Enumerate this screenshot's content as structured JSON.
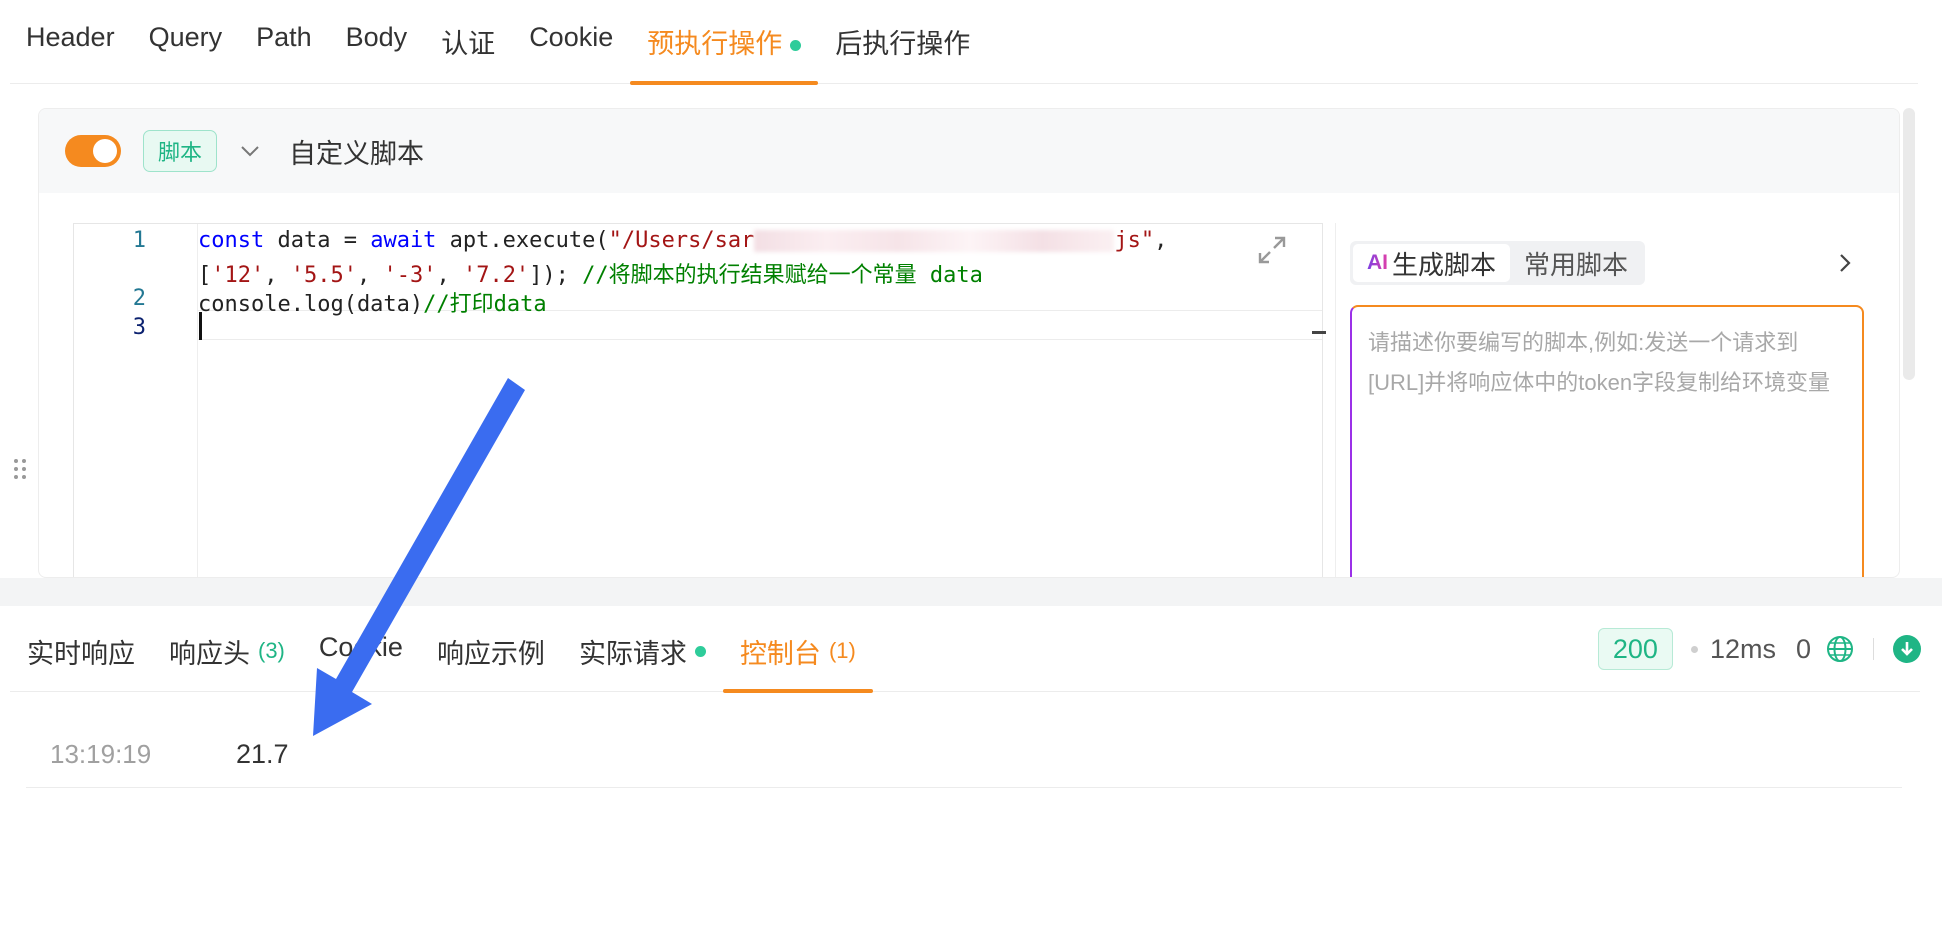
{
  "request_tabs": [
    {
      "label": "Header"
    },
    {
      "label": "Query"
    },
    {
      "label": "Path"
    },
    {
      "label": "Body"
    },
    {
      "label": "认证"
    },
    {
      "label": "Cookie"
    },
    {
      "label": "预执行操作"
    },
    {
      "label": "后执行操作"
    }
  ],
  "active_request_tab": "预执行操作",
  "script_panel": {
    "enabled": true,
    "type_tag": "脚本",
    "title": "自定义脚本"
  },
  "editor": {
    "line_numbers": [
      "1",
      "2",
      "3"
    ],
    "line1": {
      "kw1": "const",
      "plain1": " data = ",
      "kw2": "await",
      "plain2": " apt.execute(",
      "str1": "\"/Users/sar",
      "str2": "js\"",
      "plain3": ","
    },
    "line1b": {
      "plain1": "[",
      "s1": "'12'",
      "s2": "'5.5'",
      "s3": "'-3'",
      "s4": "'7.2'",
      "plain2": "]); ",
      "comment": "//将脚本的执行结果赋给一个常量 data"
    },
    "line2": {
      "plain": "console.log(data)",
      "comment": "//打印data"
    }
  },
  "ai_panel": {
    "tabs": [
      {
        "icon": "ai-logo",
        "label": "生成脚本"
      },
      {
        "label": "常用脚本"
      }
    ],
    "placeholder": "请描述你要编写的脚本,例如:发送一个请求到[URL]并将响应体中的token字段复制给环境变量"
  },
  "response_tabs": [
    {
      "label": "实时响应"
    },
    {
      "label": "响应头",
      "count": "(3)"
    },
    {
      "label": "Cookie"
    },
    {
      "label": "响应示例"
    },
    {
      "label": "实际请求"
    },
    {
      "label": "控制台",
      "count": "(1)"
    }
  ],
  "active_response_tab": "控制台",
  "status": {
    "code": "200",
    "time": "12ms",
    "size": "0"
  },
  "console_logs": [
    {
      "time": "13:19:19",
      "value": "21.7"
    }
  ],
  "colors": {
    "accent": "#f58a1f",
    "success": "#1fb585",
    "annotation_arrow": "#3a6cf0"
  }
}
